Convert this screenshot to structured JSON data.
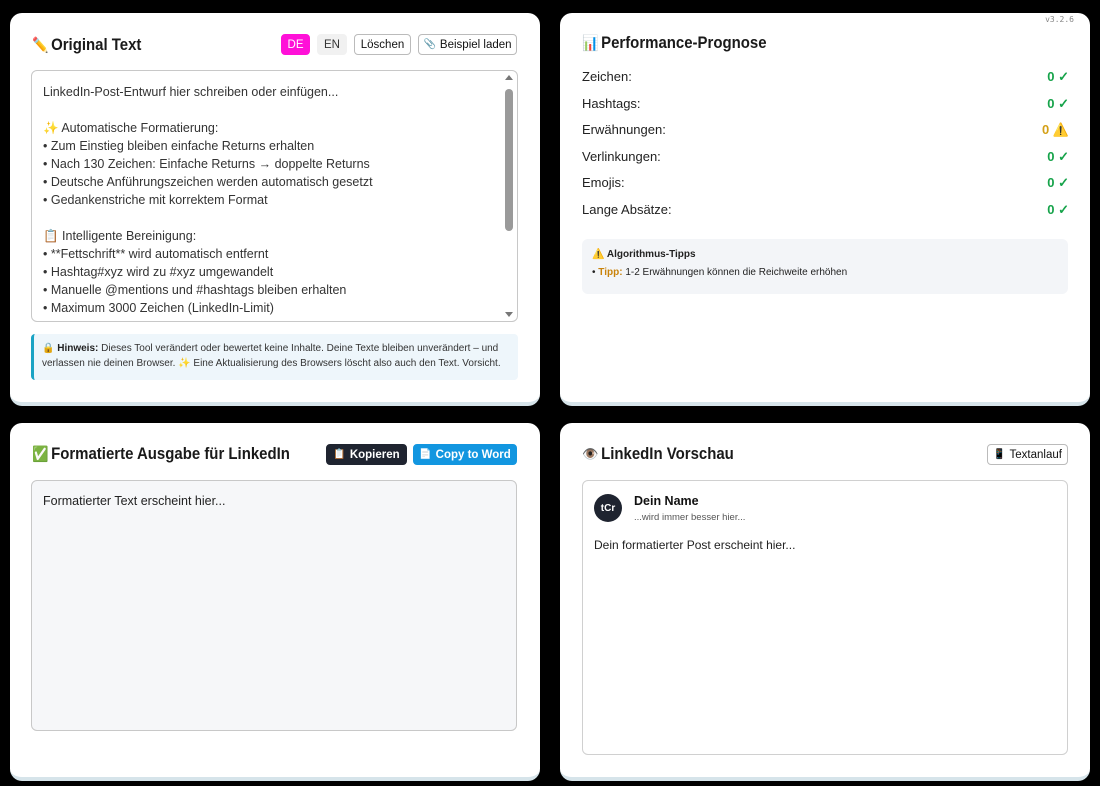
{
  "version": "v3.2.6",
  "original": {
    "icon": "✏️",
    "title": "Original Text",
    "lang_de": "DE",
    "lang_en": "EN",
    "clear_label": "Löschen",
    "example_icon": "📎",
    "example_label": "Beispiel laden",
    "placeholder_lines": [
      "LinkedIn-Post-Entwurf hier schreiben oder einfügen...",
      "",
      "✨ Automatische Formatierung:",
      "• Zum Einstieg bleiben einfache Returns erhalten",
      "• Nach 130 Zeichen: Einfache Returns → doppelte Returns",
      "• Deutsche Anführungszeichen werden automatisch gesetzt",
      "• Gedankenstriche mit korrektem Format",
      "",
      "📋 Intelligente Bereinigung:",
      "• **Fettschrift** wird automatisch entfernt",
      "• Hashtag#xyz wird zu #xyz umgewandelt",
      "• Manuelle @mentions und #hashtags bleiben erhalten",
      "• Maximum 3000 Zeichen (LinkedIn-Limit)"
    ],
    "hint_icon": "🔒",
    "hint_label": "Hinweis:",
    "hint_text": " Dieses Tool verändert oder bewertet keine Inhalte. Deine Texte bleiben unverändert – und verlassen nie deinen Browser. ✨ Eine Aktualisierung des Browsers löscht also auch den Text. Vorsicht."
  },
  "performance": {
    "icon": "📊",
    "title": "Performance-Prognose",
    "metrics": [
      {
        "label": "Zeichen:",
        "value": "0 ✓",
        "status": "ok"
      },
      {
        "label": "Hashtags:",
        "value": "0 ✓",
        "status": "ok"
      },
      {
        "label": "Erwähnungen:",
        "value": "0 ⚠️",
        "status": "warn"
      },
      {
        "label": "Verlinkungen:",
        "value": "0 ✓",
        "status": "ok"
      },
      {
        "label": "Emojis:",
        "value": "0 ✓",
        "status": "ok"
      },
      {
        "label": "Lange Absätze:",
        "value": "0 ✓",
        "status": "ok"
      }
    ],
    "tips_title": "⚠️ Algorithmus-Tipps",
    "tip_bullet": "• ",
    "tip_key": "Tipp:",
    "tip_text": " 1-2 Erwähnungen können die Reichweite erhöhen"
  },
  "output": {
    "icon": "✅",
    "title": "Formatierte Ausgabe für LinkedIn",
    "copy_icon": "📋",
    "copy_label": "Kopieren",
    "word_icon": "📄",
    "word_label": "Copy to Word",
    "placeholder": "Formatierter Text erscheint hier..."
  },
  "preview": {
    "icon": "👁️",
    "title": "LinkedIn Vorschau",
    "flow_icon": "📱",
    "flow_label": "Textanlauf",
    "avatar_text": "tCr",
    "author_name": "Dein Name",
    "author_sub": "...wird immer besser hier...",
    "post_placeholder": "Dein formatierter Post erscheint hier..."
  }
}
